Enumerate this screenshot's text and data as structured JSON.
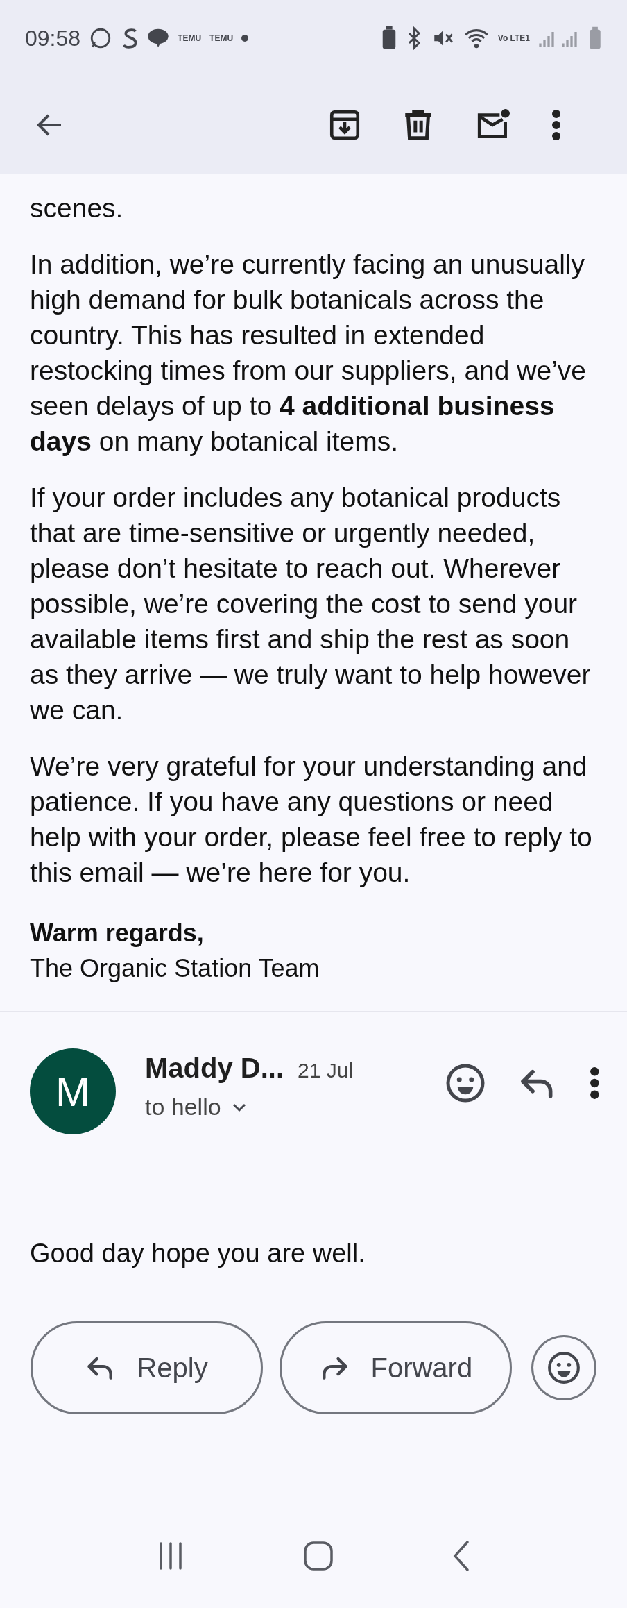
{
  "status_bar": {
    "time": "09:58",
    "notification_labels": [
      "TEMU",
      "TEMU"
    ],
    "network_label": "Vo LTE1"
  },
  "toolbar": {
    "actions": [
      {
        "kind": "archive"
      },
      {
        "kind": "delete"
      },
      {
        "kind": "mark-unread"
      },
      {
        "kind": "more"
      }
    ]
  },
  "message_body": {
    "paragraphs": [
      "scenes.",
      "In addition, we’re currently facing an unusually high demand for bulk botanicals across the country. This has resulted in extended restocking times from our suppliers, and we’ve seen delays of up to **4 additional business days** on many botanical items.",
      "If your order includes any botanical products that are time-sensitive or urgently needed, please don’t hesitate to reach out. Wherever possible, we’re covering the cost to send your available items first and ship the rest as soon as they arrive — we truly want to help however we can.",
      "We’re very grateful for your understanding and patience. If you have any questions or need help with your order, please feel free to reply to this email — we’re here for you."
    ],
    "signoff": "Warm regards,",
    "signature": "The Organic Station Team"
  },
  "reply_message": {
    "avatar_letter": "M",
    "sender": "Maddy D...",
    "date": "21 Jul",
    "recipient": "to hello",
    "body": "Good day hope you are well."
  },
  "buttons": [
    {
      "kind": "reply",
      "label": "Reply"
    },
    {
      "kind": "forward",
      "label": "Forward"
    },
    {
      "kind": "emoji"
    }
  ]
}
